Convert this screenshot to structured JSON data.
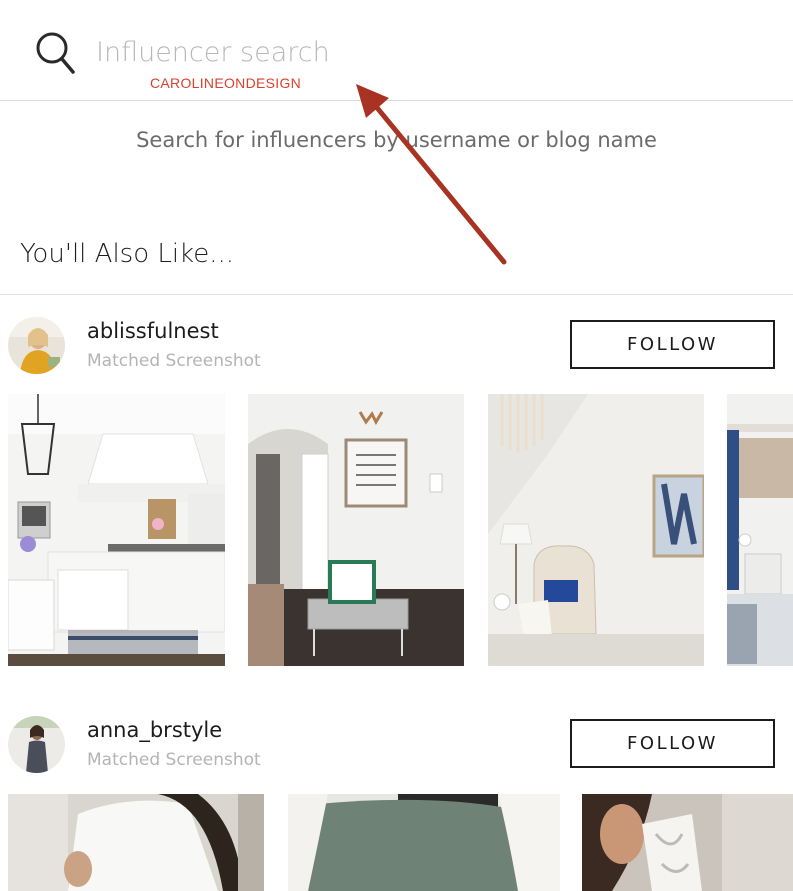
{
  "search": {
    "placeholder": "Influencer search",
    "watermark": "CAROLINEONDESIGN",
    "hint": "Search for influencers by username or blog name"
  },
  "section": {
    "title": "You'll Also Like..."
  },
  "influencers": [
    {
      "username": "ablissfulnest",
      "subtitle": "Matched Screenshot",
      "follow_label": "FOLLOW"
    },
    {
      "username": "anna_brstyle",
      "subtitle": "Matched Screenshot",
      "follow_label": "FOLLOW"
    }
  ],
  "colors": {
    "watermark": "#d8412f",
    "annotation_arrow": "#a93322",
    "follow_border": "#1c1c1c"
  },
  "icons": {
    "search": "search-icon",
    "annotation": "arrow-annotation"
  }
}
